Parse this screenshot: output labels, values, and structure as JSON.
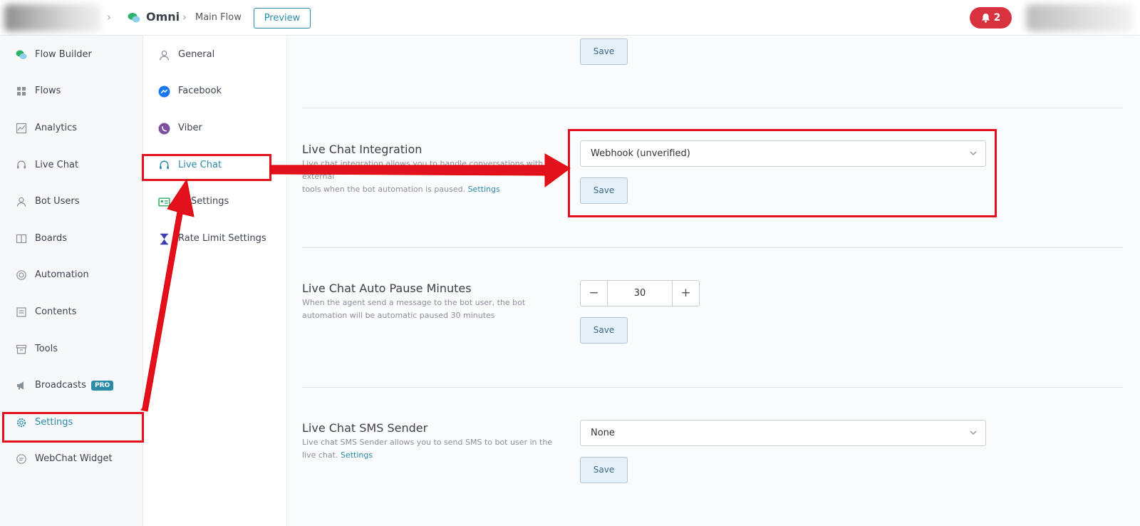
{
  "topbar": {
    "project_name": "Omni",
    "flow_name": "Main Flow",
    "preview_label": "Preview",
    "notification_count": "2"
  },
  "sidebar": {
    "items": [
      {
        "label": "Flow Builder",
        "icon": "chat-bubbles-icon"
      },
      {
        "label": "Flows",
        "icon": "grid-icon"
      },
      {
        "label": "Analytics",
        "icon": "chart-icon"
      },
      {
        "label": "Live Chat",
        "icon": "headset-icon"
      },
      {
        "label": "Bot Users",
        "icon": "user-icon"
      },
      {
        "label": "Boards",
        "icon": "board-icon"
      },
      {
        "label": "Automation",
        "icon": "lifebuoy-icon"
      },
      {
        "label": "Contents",
        "icon": "document-icon"
      },
      {
        "label": "Tools",
        "icon": "archive-icon"
      },
      {
        "label": "Broadcasts",
        "icon": "megaphone-icon",
        "badge": "PRO"
      },
      {
        "label": "Settings",
        "icon": "gear-icon",
        "active": true
      },
      {
        "label": "WebChat Widget",
        "icon": "chat-icon"
      }
    ]
  },
  "submenu": {
    "items": [
      {
        "label": "General",
        "icon": "user-icon"
      },
      {
        "label": "Facebook",
        "icon": "messenger-icon"
      },
      {
        "label": "Viber",
        "icon": "viber-icon"
      },
      {
        "label": "Live Chat",
        "icon": "headset-icon",
        "active": true
      },
      {
        "label": "ID Settings",
        "icon": "id-card-icon"
      },
      {
        "label": "Rate Limit Settings",
        "icon": "hourglass-icon"
      }
    ]
  },
  "sections": {
    "top": {
      "save_label": "Save"
    },
    "integration": {
      "title": "Live Chat Integration",
      "desc_line1": "Live chat integration allows you to handle conversations with external",
      "desc_line2": "tools when the bot automation is paused.",
      "desc_link": "Settings",
      "select_value": "Webhook (unverified)",
      "save_label": "Save"
    },
    "auto_pause": {
      "title": "Live Chat Auto Pause Minutes",
      "desc_line1": "When the agent send a message to the bot user, the bot",
      "desc_line2": "automation will be automatic paused 30 minutes",
      "minus": "−",
      "value": "30",
      "plus": "+",
      "save_label": "Save"
    },
    "sms": {
      "title": "Live Chat SMS Sender",
      "desc_line1": "Live chat SMS Sender allows you to send SMS to bot user in the",
      "desc_line2": "live chat.",
      "desc_link": "Settings",
      "select_value": "None",
      "save_label": "Save"
    }
  },
  "colors": {
    "accent": "#2b8aa8",
    "annotation_red": "#e3101d",
    "notification_red": "#d7323d"
  }
}
